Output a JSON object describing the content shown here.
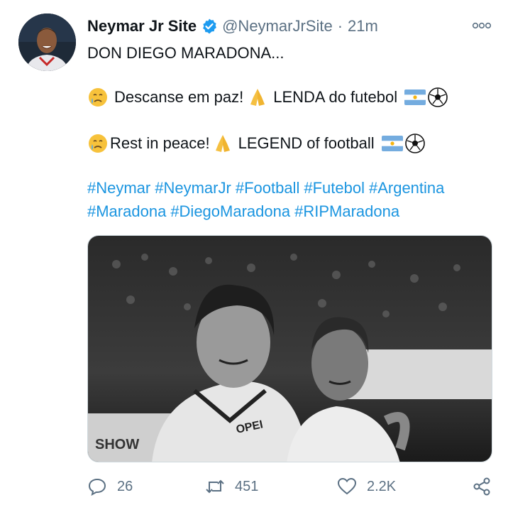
{
  "tweet": {
    "author_name": "Neymar Jr Site",
    "handle": "@NeymarJrSite",
    "separator": "·",
    "time": "21m",
    "line1": "DON DIEGO MARADONA...",
    "line2_a": "Descanse em paz!",
    "line2_b": "LENDA do futebol",
    "line3_a": "Rest in peace!",
    "line3_b": "LEGEND of football",
    "hashtags_row1": [
      "#Neymar",
      "#NeymarJr",
      "#Football",
      "#Futebol",
      "#Argentina"
    ],
    "hashtags_row2": [
      "#Maradona",
      "#DiegoMaradona",
      "#RIPMaradona"
    ],
    "photo_texts": {
      "jersey": "OPEI",
      "board": "SHOW"
    }
  },
  "actions": {
    "replies": "26",
    "retweets": "451",
    "likes": "2.2K"
  },
  "colors": {
    "accent": "#1d9bf0",
    "hashtag": "#1b95e0",
    "secondary": "#5b7083"
  },
  "icons": [
    "verified-badge-icon",
    "more-options-icon",
    "crying-face-emoji",
    "folded-hands-emoji",
    "argentina-flag-emoji",
    "soccer-ball-emoji",
    "reply-icon",
    "retweet-icon",
    "like-icon",
    "share-icon"
  ]
}
